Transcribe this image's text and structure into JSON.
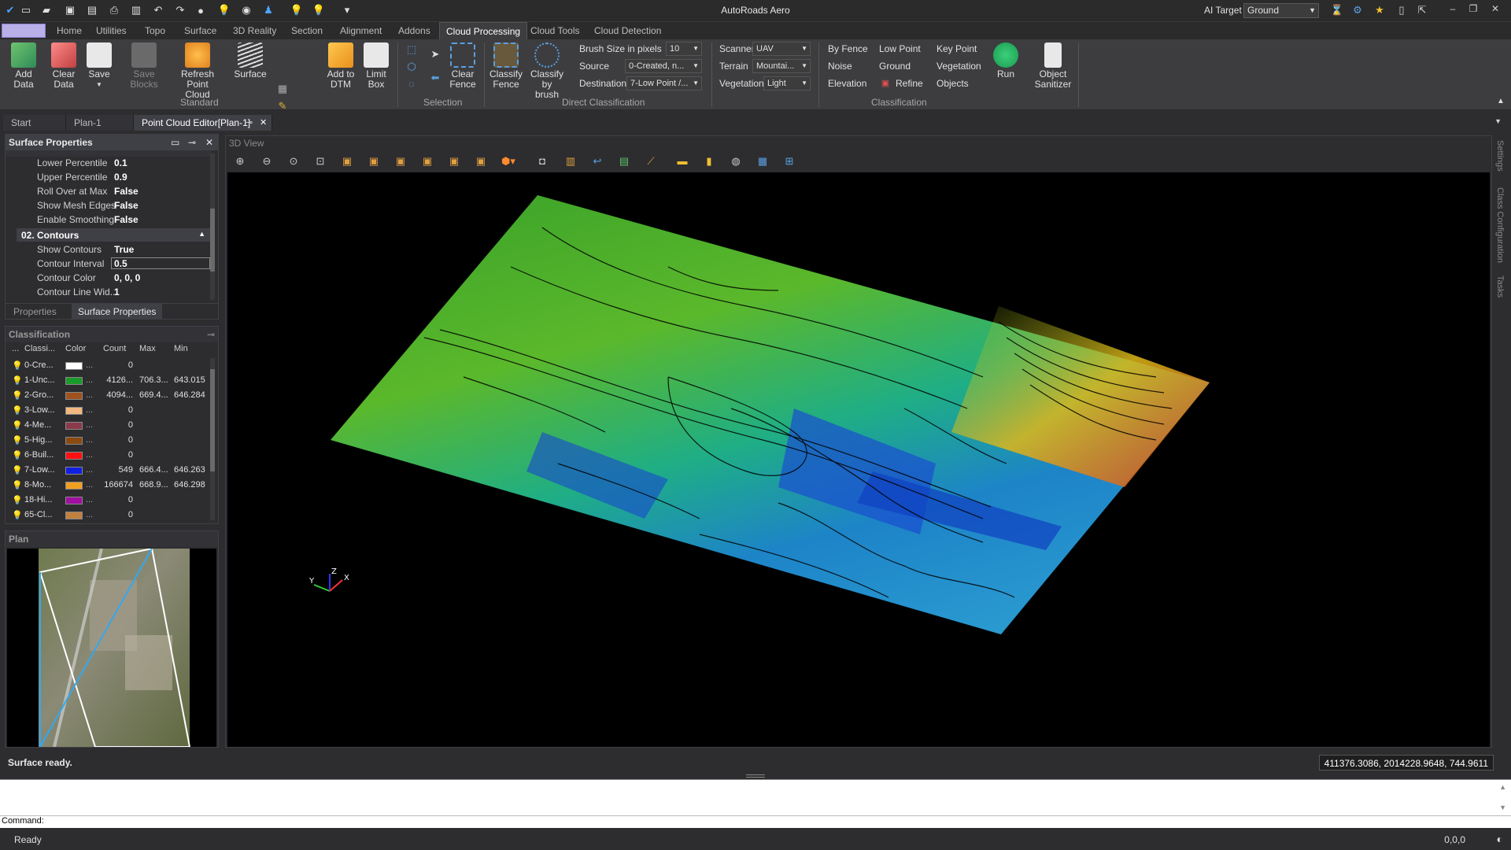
{
  "app": {
    "title": "AutoRoads Aero"
  },
  "ai_target": {
    "label": "AI Target",
    "value": "Ground"
  },
  "menu": {
    "tabs": [
      "Home",
      "Utilities",
      "Topo",
      "Surface",
      "3D Reality",
      "Section",
      "Alignment",
      "Addons",
      "Cloud Processing",
      "Cloud Tools",
      "Cloud Detection"
    ],
    "active": "Cloud Processing"
  },
  "ribbon": {
    "standard": {
      "label": "Standard",
      "add_data": "Add Data",
      "clear_data_1": "Clear",
      "clear_data_2": "Data",
      "save": "Save",
      "save_blocks": "Save Blocks",
      "refresh_1": "Refresh",
      "refresh_2": "Point Cloud",
      "surface": "Surface",
      "add_dtm_1": "Add to",
      "add_dtm_2": "DTM",
      "limit_box_1": "Limit",
      "limit_box_2": "Box"
    },
    "selection": {
      "label": "Selection",
      "clear_fence_1": "Clear",
      "clear_fence_2": "Fence"
    },
    "direct": {
      "label": "Direct Classification",
      "classify_fence_1": "Classify",
      "classify_fence_2": "Fence",
      "classify_brush_1": "Classify",
      "classify_brush_2": "by brush",
      "brush_size_label": "Brush Size in pixels",
      "brush_size_value": "10",
      "source_label": "Source",
      "source_value": "0-Created, n...",
      "destination_label": "Destination",
      "destination_value": "7-Low Point /..."
    },
    "classification": {
      "label": "Classification",
      "scanner_label": "Scanner",
      "scanner_value": "UAV",
      "terrain_label": "Terrain",
      "terrain_value": "Mountai...",
      "vegetation_label": "Vegetation",
      "vegetation_value": "Light",
      "by_fence": "By Fence",
      "noise": "Noise",
      "elevation": "Elevation",
      "low_point": "Low Point",
      "ground": "Ground",
      "refine": "Refine",
      "key_point": "Key Point",
      "vegetation": "Vegetation",
      "objects": "Objects",
      "run": "Run",
      "sanitizer_1": "Object",
      "sanitizer_2": "Sanitizer"
    }
  },
  "doc_tabs": {
    "start": "Start",
    "plan": "Plan-1",
    "editor": "Point Cloud Editor[Plan-1]"
  },
  "surface_props": {
    "title": "Surface Properties",
    "rows": [
      {
        "k": "Lower Percentile",
        "v": "0.1"
      },
      {
        "k": "Upper Percentile",
        "v": "0.9"
      },
      {
        "k": "Roll Over at Max",
        "v": "False"
      },
      {
        "k": "Show Mesh Edges",
        "v": "False"
      },
      {
        "k": "Enable Smoothing",
        "v": "False"
      }
    ],
    "section": "02. Contours",
    "rows2": [
      {
        "k": "Show Contours",
        "v": "True"
      },
      {
        "k": "Contour Interval",
        "v": "0.5"
      },
      {
        "k": "Contour Color",
        "v": "0, 0, 0"
      },
      {
        "k": "Contour Line Wid...",
        "v": "1"
      }
    ],
    "tab_properties": "Properties",
    "tab_surface": "Surface Properties"
  },
  "classification": {
    "title": "Classification",
    "headers": [
      "...",
      "Classi...",
      "Color",
      "Count",
      "Max",
      "Min"
    ],
    "rows": [
      {
        "name": "0-Cre...",
        "color": "#ffffff",
        "count": "0",
        "max": "",
        "min": ""
      },
      {
        "name": "1-Unc...",
        "color": "#1a9a2a",
        "count": "4126...",
        "max": "706.3...",
        "min": "643.015"
      },
      {
        "name": "2-Gro...",
        "color": "#a0521e",
        "count": "4094...",
        "max": "669.4...",
        "min": "646.284"
      },
      {
        "name": "3-Low...",
        "color": "#f2b880",
        "count": "0",
        "max": "",
        "min": ""
      },
      {
        "name": "4-Me...",
        "color": "#8a3a4a",
        "count": "0",
        "max": "",
        "min": ""
      },
      {
        "name": "5-Hig...",
        "color": "#8a4a10",
        "count": "0",
        "max": "",
        "min": ""
      },
      {
        "name": "6-Buil...",
        "color": "#ff1010",
        "count": "0",
        "max": "",
        "min": ""
      },
      {
        "name": "7-Low...",
        "color": "#1020e0",
        "count": "549",
        "max": "666.4...",
        "min": "646.263"
      },
      {
        "name": "8-Mo...",
        "color": "#f0a020",
        "count": "166674",
        "max": "668.9...",
        "min": "646.298"
      },
      {
        "name": "18-Hi...",
        "color": "#a010a0",
        "count": "0",
        "max": "",
        "min": ""
      },
      {
        "name": "65-Cl...",
        "color": "#c08040",
        "count": "0",
        "max": "",
        "min": ""
      }
    ]
  },
  "plan": {
    "title": "Plan"
  },
  "view3d": {
    "title": "3D View"
  },
  "status": {
    "message": "Surface ready.",
    "coords": "411376.3086, 2014228.9648, 744.9611",
    "ready": "Ready",
    "xy": "0,0,0"
  },
  "command": {
    "label": "Command:"
  }
}
